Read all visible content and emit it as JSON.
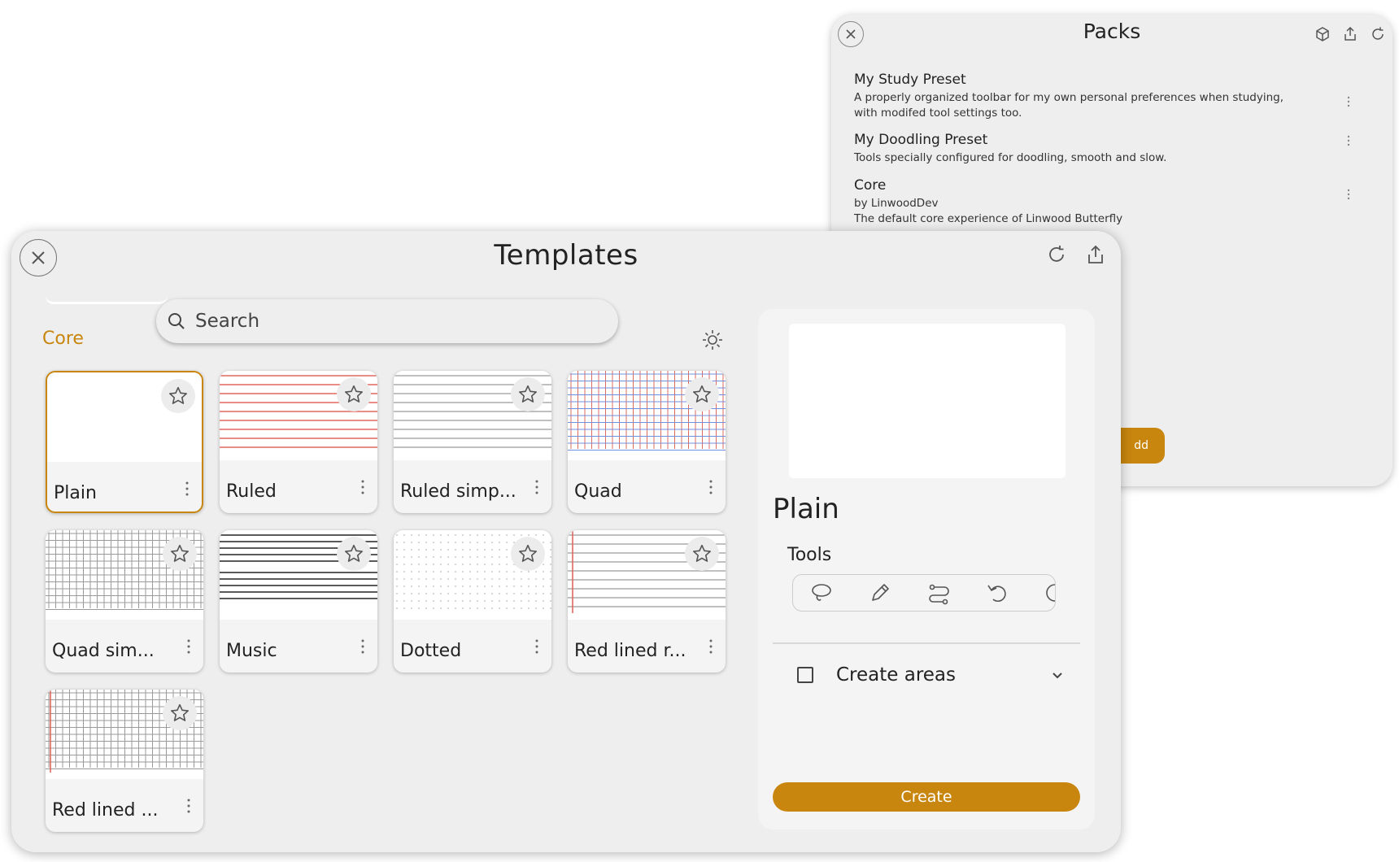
{
  "packs": {
    "title": "Packs",
    "add_label": "dd",
    "items": [
      {
        "name": "My Study Preset",
        "lines": [
          "A properly organized toolbar for my own personal preferences when studying,",
          "with modifed tool settings too."
        ]
      },
      {
        "name": "My Doodling Preset",
        "lines": [
          "Tools specially configured for doodling, smooth and slow."
        ]
      },
      {
        "name": "Core",
        "lines": [
          "by LinwoodDev",
          "The default core experience of Linwood Butterfly"
        ]
      }
    ]
  },
  "templates": {
    "title": "Templates",
    "search": {
      "placeholder": "Search",
      "value": ""
    },
    "section_label": "Core",
    "cards": [
      {
        "label": "Plain",
        "pattern": "plain",
        "selected": true
      },
      {
        "label": "Ruled",
        "pattern": "ruled"
      },
      {
        "label": "Ruled simp...",
        "pattern": "ruled-simple"
      },
      {
        "label": "Quad",
        "pattern": "quad"
      },
      {
        "label": "Quad sim...",
        "pattern": "quad-simple"
      },
      {
        "label": "Music",
        "pattern": "music"
      },
      {
        "label": "Dotted",
        "pattern": "dotted"
      },
      {
        "label": "Red lined r...",
        "pattern": "red-lined-ruled"
      },
      {
        "label": "Red lined ...",
        "pattern": "red-lined-quad"
      }
    ],
    "preview": {
      "name": "Plain",
      "tools_label": "Tools",
      "tools": [
        "lasso-icon",
        "pen-icon",
        "path-icon",
        "undo-icon",
        "redo-icon"
      ],
      "areas_label": "Create areas",
      "create_label": "Create"
    }
  },
  "colors": {
    "accent": "#c8860e",
    "ruled_red": "#e0685e",
    "quad_blue": "#6f8fe0",
    "line_gray": "#9a9a9a"
  }
}
